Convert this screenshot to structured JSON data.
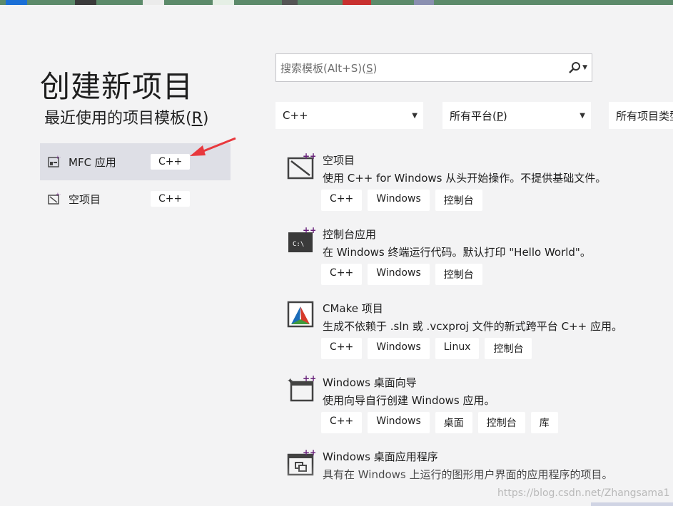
{
  "page": {
    "title": "创建新项目",
    "recent_title_prefix": "最近使用的项目模板(",
    "recent_title_key": "R",
    "recent_title_suffix": ")"
  },
  "recent": [
    {
      "name": "MFC 应用",
      "tag": "C++",
      "selected": true,
      "icon": "mfc-app-icon"
    },
    {
      "name": "空项目",
      "tag": "C++",
      "selected": false,
      "icon": "empty-project-icon"
    }
  ],
  "search": {
    "placeholder_prefix": "搜索模板(Alt+S)(",
    "placeholder_key": "S",
    "placeholder_suffix": ")"
  },
  "filters": {
    "language": "C++",
    "platform_prefix": "所有平台(",
    "platform_key": "P",
    "platform_suffix": ")",
    "type": "所有项目类型"
  },
  "templates": [
    {
      "name": "空项目",
      "desc": "使用 C++ for Windows 从头开始操作。不提供基础文件。",
      "tags": [
        "C++",
        "Windows",
        "控制台"
      ],
      "icon": "empty-project-icon"
    },
    {
      "name": "控制台应用",
      "desc": "在 Windows 终端运行代码。默认打印 \"Hello World\"。",
      "tags": [
        "C++",
        "Windows",
        "控制台"
      ],
      "icon": "console-app-icon"
    },
    {
      "name": "CMake 项目",
      "desc": "生成不依赖于 .sln 或 .vcxproj 文件的新式跨平台 C++ 应用。",
      "tags": [
        "C++",
        "Windows",
        "Linux",
        "控制台"
      ],
      "icon": "cmake-icon"
    },
    {
      "name": "Windows 桌面向导",
      "desc": "使用向导自行创建 Windows 应用。",
      "tags": [
        "C++",
        "Windows",
        "桌面",
        "控制台",
        "库"
      ],
      "icon": "desktop-wizard-icon"
    },
    {
      "name": "Windows 桌面应用程序",
      "desc": "具有在 Windows 上运行的图形用户界面的应用程序的项目。",
      "tags": [],
      "icon": "desktop-app-icon"
    }
  ],
  "watermark": "https://blog.csdn.net/Zhangsama1",
  "colors": {
    "accent": "#68217a",
    "selected_bg": "#dedfe6",
    "arrow": "#e8383d"
  }
}
